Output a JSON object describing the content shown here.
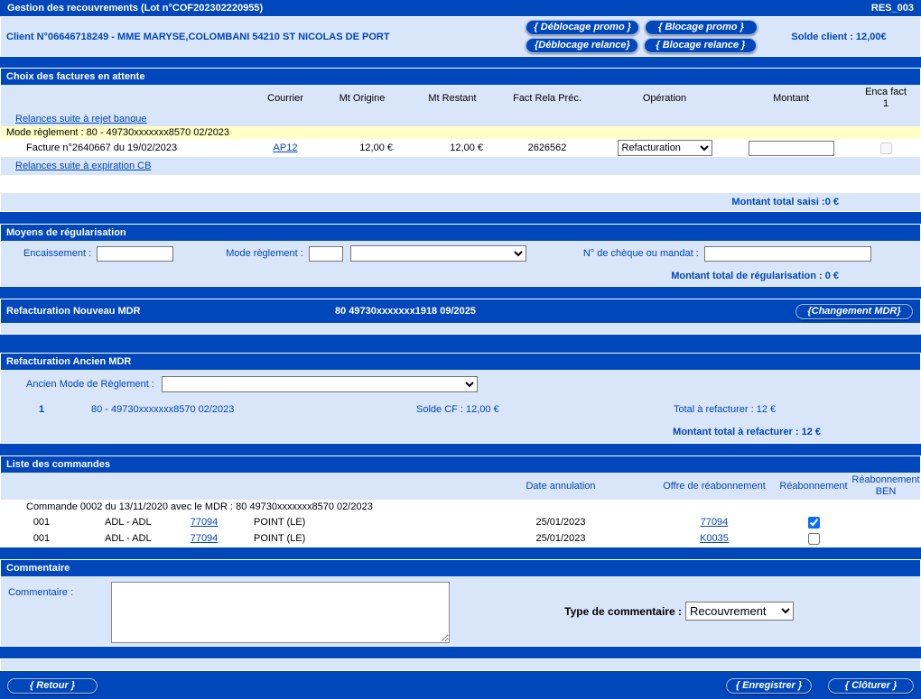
{
  "colors": {
    "brand_blue": "#0047BB",
    "pale_blue": "#D9E5F8",
    "highlight_yellow": "#FFFFC6",
    "link_blue": "#0047BB",
    "checkbox_accent": "#0A6CFF"
  },
  "header": {
    "title": "Gestion des recouvrements (Lot n°COF202302220955)",
    "code": "RES_003"
  },
  "client": {
    "label": "Client N°06646718249 - MME MARYSE,COLOMBANI 54210 ST NICOLAS DE PORT",
    "solde": "Solde client : 12,00€",
    "btn_deblocage_promo": "{  Déblocage promo  }",
    "btn_blocage_promo": "{  Blocage promo  }",
    "btn_deblocage_relance": "{Déblocage relance}",
    "btn_blocage_relance": "{ Blocage relance }"
  },
  "factures": {
    "title": "Choix des factures en attente",
    "col_courrier": "Courrier",
    "col_mt_origine": "Mt Origine",
    "col_mt_restant": "Mt Restant",
    "col_fact_rela": "Fact Rela Préc.",
    "col_operation": "Opération",
    "col_montant": "Montant",
    "col_enca_fact": "Enca fact",
    "col_enca_fact_num": "1",
    "link_rejet_banque": "Relances suite à rejet banque",
    "mode_reglement": "Mode règlement : 80 - 49730xxxxxxx8570 02/2023",
    "facture_label": "Facture n°2640667 du 19/02/2023",
    "facture_courrier": "AP12",
    "facture_mt_origine": "12,00 €",
    "facture_mt_restant": "12,00 €",
    "facture_fact_rela": "2626562",
    "facture_operation": "Refacturation",
    "montant_value": "",
    "link_expiration_cb": "Relances suite à expiration CB",
    "total_saisi": "Montant total saisi :0 €"
  },
  "regularisation": {
    "title": "Moyens de régularisation",
    "label_encaissement": "Encaissement :",
    "label_mode_reglement": "Mode règlement :",
    "label_cheque": "N° de chèque ou mandat :",
    "total": "Montant total de régularisation : 0 €"
  },
  "nouveau_mdr": {
    "title": "Refacturation Nouveau MDR",
    "value": "80 49730xxxxxxx1918 09/2025",
    "btn_changement": "{Changement MDR}"
  },
  "ancien_mdr": {
    "title": "Refacturation Ancien MDR",
    "label": "Ancien Mode de Règlement :",
    "row_num": "1",
    "row_mdr": "80 - 49730xxxxxxx8570 02/2023",
    "row_solde": "Solde CF : 12,00 €",
    "row_total": "Total à refacturer : 12 €",
    "total": "Montant total à refacturer : 12 €"
  },
  "commandes": {
    "title": "Liste des commandes",
    "col_date_annulation": "Date annulation",
    "col_offre": "Offre de réabonnement",
    "col_reabonnement": "Réabonnement",
    "col_reabonnement_ben_line1": "Réabonnement",
    "col_reabonnement_ben_line2": "BEN",
    "commande_header": "Commande 0002 du 13/11/2020 avec le MDR : 80 49730xxxxxxx8570 02/2023",
    "rows": [
      {
        "num": "001",
        "type": "ADL - ADL",
        "code": "77094",
        "name": "POINT (LE)",
        "date": "25/01/2023",
        "offre": "77094",
        "checked": true
      },
      {
        "num": "001",
        "type": "ADL - ADL",
        "code": "77094",
        "name": "POINT (LE)",
        "date": "25/01/2023",
        "offre": "K0035",
        "checked": false
      }
    ]
  },
  "commentaire": {
    "title": "Commentaire",
    "label": "Commentaire :",
    "type_label": "Type de commentaire :",
    "type_value": "Recouvrement"
  },
  "footer": {
    "btn_retour": "{    Retour    }",
    "btn_enregistrer": "{ Enregistrer }",
    "btn_cloturer": "{  Clôturer  }"
  }
}
